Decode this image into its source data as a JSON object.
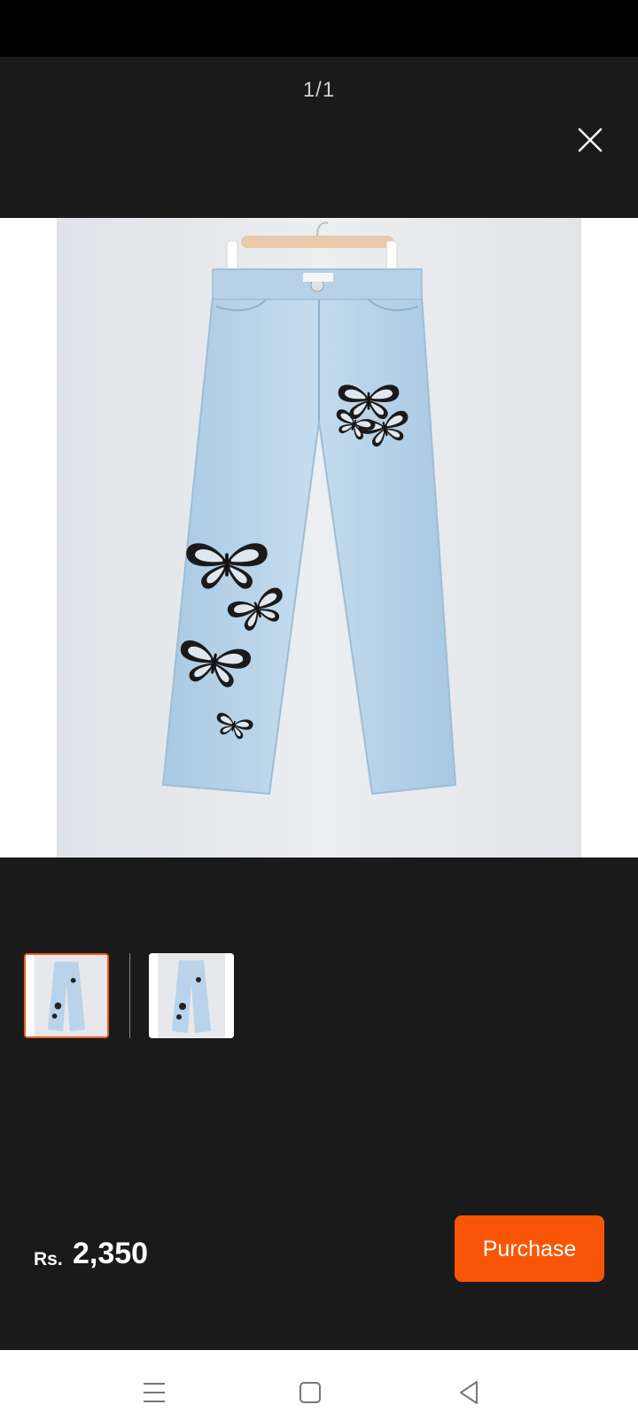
{
  "viewer": {
    "counter": "1/1",
    "close_icon": "close-icon"
  },
  "product_image": {
    "subject": "light-blue wide-leg jeans with black butterfly prints on hanger"
  },
  "thumbnails": [
    {
      "label": "thumbnail 1",
      "selected": true
    },
    {
      "label": "thumbnail 2",
      "selected": false
    }
  ],
  "price": {
    "currency": "Rs.",
    "amount": "2,350"
  },
  "actions": {
    "purchase_label": "Purchase"
  },
  "colors": {
    "accent": "#f85606",
    "selected_border": "#f05a1a",
    "background": "#1a1a1a",
    "jeans": "#bcd6ea"
  },
  "nav": {
    "icons": [
      "menu-icon",
      "home-square-icon",
      "back-triangle-icon"
    ]
  }
}
